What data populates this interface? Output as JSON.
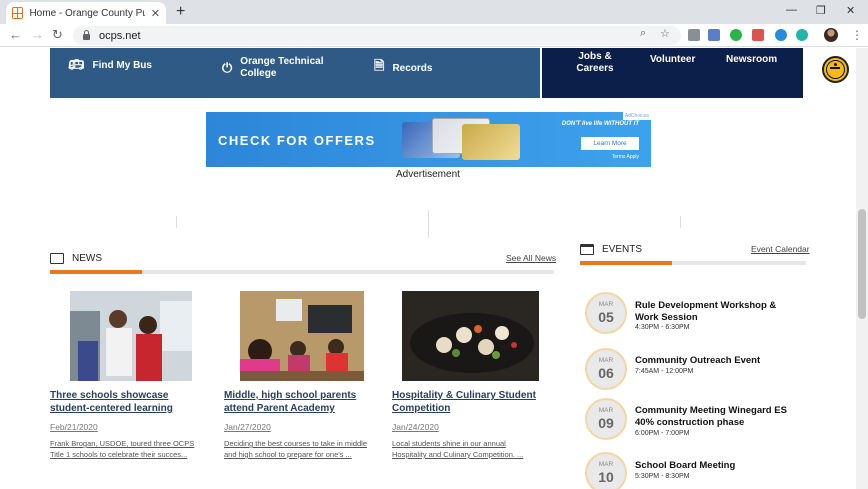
{
  "browser": {
    "tab_title": "Home - Orange County Public Sc",
    "url": "ocps.net"
  },
  "quicklinks": [
    {
      "label": "Find My Bus",
      "icon": "bus-icon"
    },
    {
      "label": "Orange Technical College",
      "icon": "power-icon"
    },
    {
      "label": "Records",
      "icon": "document-icon"
    }
  ],
  "utility_links": [
    "Jobs & Careers",
    "Volunteer",
    "Newsroom"
  ],
  "ad": {
    "headline": "CHECK FOR OFFERS",
    "tagline": "DON'T live life WITHOUT IT",
    "button": "Learn More",
    "terms": "Terms Apply",
    "choices": "AdChoices",
    "label": "Advertisement"
  },
  "news": {
    "heading": "NEWS",
    "see_all": "See All News",
    "items": [
      {
        "title": "Three schools showcase student-centered learning",
        "date": "Feb/21/2020",
        "snippet": "Frank Brogan, USDOE, toured three OCPS Title 1 schools to celebrate their succes..."
      },
      {
        "title": "Middle, high school parents attend Parent Academy",
        "date": "Jan/27/2020",
        "snippet": "Deciding the best courses to take in middle and high school to prepare for one's ..."
      },
      {
        "title": "Hospitality & Culinary Student Competition",
        "date": "Jan/24/2020",
        "snippet": "Local students shine in our annual Hospitality and Culinary Competition. ..."
      }
    ]
  },
  "events": {
    "heading": "EVENTS",
    "calendar_link": "Event Calendar",
    "items": [
      {
        "month": "MAR",
        "day": "05",
        "title": "Rule Development Workshop & Work Session",
        "time": "4:30PM - 6:30PM"
      },
      {
        "month": "MAR",
        "day": "06",
        "title": "Community Outreach Event",
        "time": "7:45AM - 12:00PM"
      },
      {
        "month": "MAR",
        "day": "09",
        "title": "Community Meeting Winegard ES 40% construction phase",
        "time": "6:00PM - 7:00PM"
      },
      {
        "month": "MAR",
        "day": "10",
        "title": "School Board Meeting",
        "time": "5:30PM - 8:30PM"
      }
    ]
  },
  "colors": {
    "quicklinks_bg": "#2f5a85",
    "utility_bg": "#0c1e4a",
    "accent_orange": "#e8771d",
    "accessibility_yellow": "#f6b917"
  }
}
